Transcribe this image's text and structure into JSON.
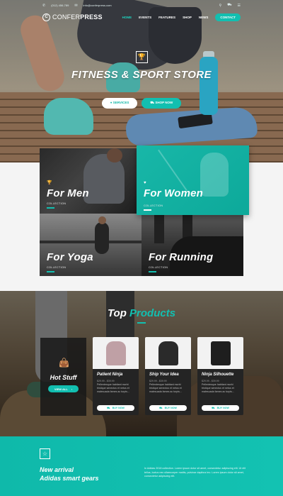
{
  "topbar": {
    "phone": "(012) 456-789",
    "email": "info@conferpress.com",
    "icons": [
      "search-icon",
      "cart-icon",
      "menu-icon"
    ]
  },
  "nav": {
    "logo_prefix": "CONFER",
    "logo_bold": "PRESS",
    "items": [
      {
        "label": "HOME",
        "active": true
      },
      {
        "label": "EVENTS",
        "active": false
      },
      {
        "label": "FEATURES",
        "active": false
      },
      {
        "label": "SHOP",
        "active": false
      },
      {
        "label": "NEWS",
        "active": false
      }
    ],
    "contact": "CONTACT"
  },
  "hero": {
    "title": "FITNESS & SPORT STORE",
    "btn_services": "SERVICES",
    "btn_shop": "SHOP NOW",
    "icon": "trophy-icon"
  },
  "categories": [
    {
      "title": "For Men",
      "sub": "COLLECTION",
      "icon": "trophy-icon"
    },
    {
      "title": "For Women",
      "sub": "COLLECTION",
      "icon": "heart-icon"
    },
    {
      "title": "For Yoga",
      "sub": "COLLECTION"
    },
    {
      "title": "For Running",
      "sub": "COLLECTION"
    }
  ],
  "products": {
    "title_a": "Top ",
    "title_b": "Products",
    "hot": {
      "title": "Hot Stuff",
      "btn": "VIEW ALL",
      "icon": "bag-icon"
    },
    "cards": [
      {
        "title": "Patient Ninja",
        "price": "$29.99 - $39.99",
        "desc": "Pellentesque habitant morbi tristique senectus et netus et malesuada fames ac turpis...",
        "btn": "BUY NOW",
        "color": "#bfa0a5"
      },
      {
        "title": "Ship Your Idea",
        "price": "$29.99 - $39.99",
        "desc": "Pellentesque habitant morbi tristique senectus et netus et malesuada fames ac turpis...",
        "btn": "BUY NOW",
        "color": "#2a2a2a"
      },
      {
        "title": "Ninja Silhouette",
        "price": "$29.99 - $39.99",
        "desc": "Pellentesque habitant morbi tristique senectus et netus et malesuada fames ac turpis...",
        "btn": "BUY NOW",
        "color": "#1e1e1e"
      }
    ]
  },
  "footer": {
    "line1": "New arrival",
    "line2": "Adidas smart gears",
    "text": "In Adidas 2018 collection. Lorem ipsum dolor sit amet, consectetur adipiscing elit. Ut elit tellus, luctus nec ullamcorper mattis, pulvinar dapibus leo. Lorem ipsum dolor sit amet, consectetur adipiscing elit.",
    "icon": "star-icon"
  },
  "colors": {
    "accent": "#12bfb0"
  }
}
